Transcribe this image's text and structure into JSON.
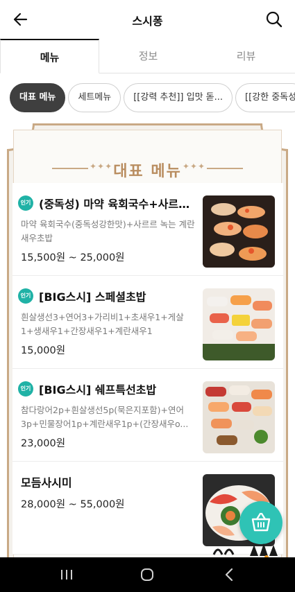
{
  "header": {
    "title": "스시퐁",
    "back_icon": "arrow-left-icon",
    "search_icon": "search-icon"
  },
  "tabs": [
    {
      "label": "메뉴",
      "active": true
    },
    {
      "label": "정보",
      "active": false
    },
    {
      "label": "리뷰",
      "active": false
    }
  ],
  "categories": [
    {
      "label": "대표 메뉴",
      "active": true
    },
    {
      "label": "세트메뉴",
      "active": false
    },
    {
      "label": "[[강력 추천]] 입맛 돋...",
      "active": false
    },
    {
      "label": "[[강한 중독성",
      "active": false
    }
  ],
  "board": {
    "title": "대표 메뉴",
    "accent_color": "#c9a985"
  },
  "menu_items": [
    {
      "badge": "인기",
      "name": "(중독성) 마약 육회국수+사르르...",
      "desc": "마약 육회국수(중독성강한맛)+사르르 녹는 계란새우초밥",
      "price": "15,500원 ~ 25,000원",
      "photo_icon": "sushi-photo"
    },
    {
      "badge": "인기",
      "name": "[BIG스시] 스페셜초밥",
      "desc": "흰살생선3+연어3+가리비1+초새우1+게살1+생새우1+간장새우1+계란새우1",
      "price": "15,000원",
      "photo_icon": "sushi-photo"
    },
    {
      "badge": "인기",
      "name": "[BIG스시] 쉐프특선초밥",
      "desc": "참다랑어2p+흰살생선5p(묵은지포함)+연어3p+민물장어1p+계란새우1p+(간장새우o...",
      "price": "23,000원",
      "photo_icon": "sushi-photo"
    },
    {
      "badge": "",
      "name": "모듬사시미",
      "desc": "",
      "price": "28,000원 ~ 55,000원",
      "photo_icon": "sashimi-photo"
    }
  ],
  "cart": {
    "icon": "basket-icon",
    "color": "#2fc3b5"
  },
  "system_nav": {
    "recents_icon": "recents-icon",
    "home_icon": "home-icon",
    "back_icon": "system-back-icon"
  }
}
